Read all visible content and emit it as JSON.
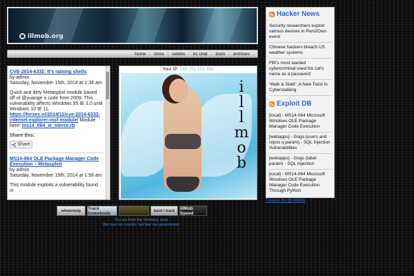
{
  "header": {
    "logo_text": "illmob.org"
  },
  "nav": {
    "items": [
      "home",
      "store",
      "celebs",
      "irc chat",
      "tools",
      "archives"
    ],
    "separator": ":"
  },
  "posts": [
    {
      "title": "CVE-2014-6332: It's raining shells",
      "author": "by admin",
      "date": "Saturday, November 15th, 2014 at 2:34 am",
      "body": "Quick and dirty Metasploit module based off of @yuange`s code from 2009. This vulnerability affects Windows 95 IE 3.0 until Windows 10 IE 11.",
      "link": "https://forsec.nl/2014/11/cve-2014-6332-internet-explorer-msf-module/",
      "body_after_link": "Module here:",
      "link2": "ms14_064_ie_olerce.rb"
    },
    {
      "title": "MS14-064 OLE Package Manager Code Execution – Metasploit",
      "author": "by admin",
      "date": "Saturday, November 15th, 2014 at 1:58 am",
      "body": "This module exploits a vulnerability found in"
    }
  ],
  "share": {
    "label": "Share this:",
    "button": "Share"
  },
  "center": {
    "ip_label": "Your IP:",
    "ip_value": "148.251.153.164",
    "art_letters": [
      "i",
      "l",
      "l",
      "m",
      "o",
      "b"
    ]
  },
  "hacker_news": {
    "title": "Hacker News",
    "items": [
      "Security researchers exploit various devices in Pwn2Own event",
      "Chinese hackers breach US weather systems",
      "FBI's most wanted cybercriminal used his cat's name as a password",
      "'Walk & Stalk': A New Twist In Cyberstalking"
    ]
  },
  "exploit_db": {
    "title": "Exploit DB",
    "items": [
      "[local] - MS14-064 Microsoft Windows OLE Package Manager Code Execution",
      "[webapps] - Gogs (users and repos q param) - SQL Injection Vulnerabilities",
      "[webapps] - Gogs (label param) - SQL Injection",
      "[local] - MS14-064 Microsoft Windows OLE Package Manager Code Execution Through Python"
    ]
  },
  "tweets_link": "Tweets by @xillwillx",
  "badges": [
    "whatsmyip",
    "Track Somebody",
    "",
    "back \\ track",
    "illMob Speed"
  ],
  "footer": {
    "line1": "You are from the Germany area.",
    "line2": "We love our country, but fear our government."
  },
  "colors": {
    "link": "#1456b8",
    "feed_title": "#2b6ad1",
    "rss": "#f08a24",
    "ip": "#5cc9f5",
    "footer_text": "#4a8fd6"
  }
}
